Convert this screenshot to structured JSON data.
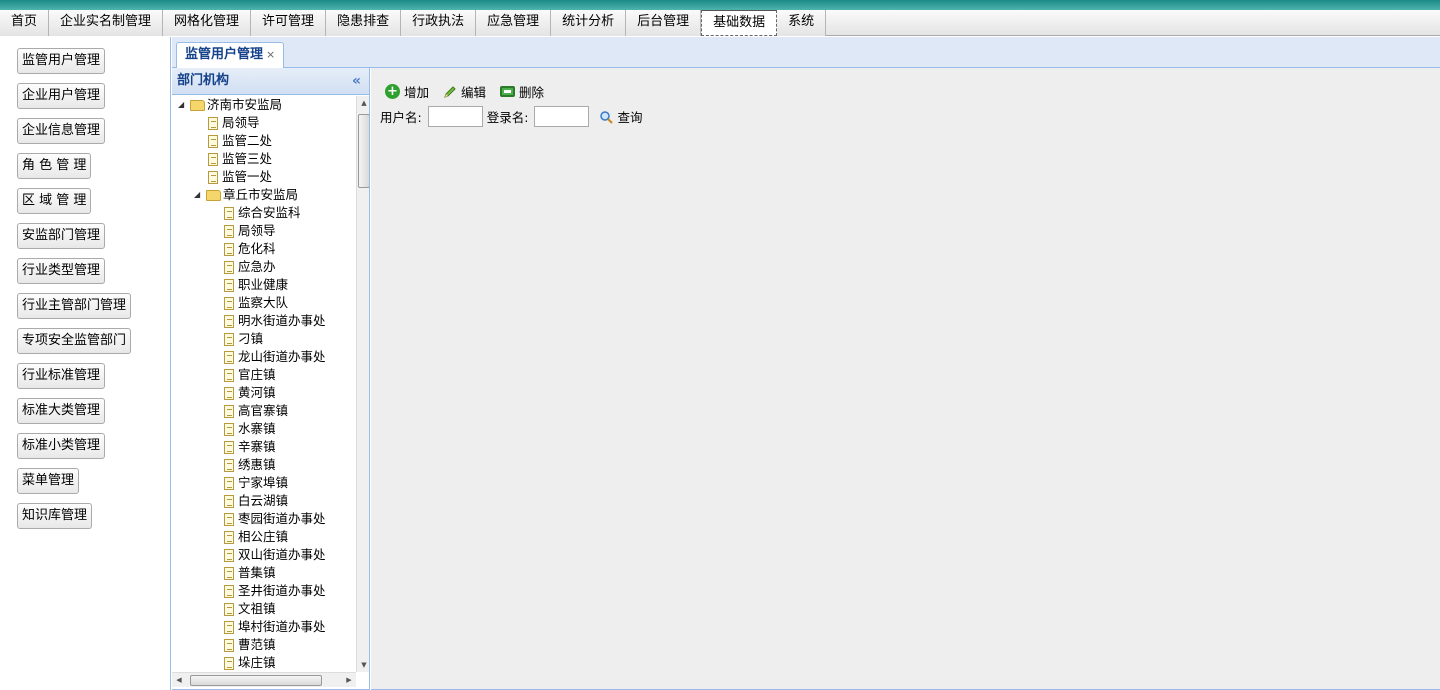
{
  "menu": {
    "items": [
      "首页",
      "企业实名制管理",
      "网格化管理",
      "许可管理",
      "隐患排查",
      "行政执法",
      "应急管理",
      "统计分析",
      "后台管理",
      "基础数据",
      "系统"
    ],
    "active": "基础数据"
  },
  "sidebar": {
    "items": [
      "监管用户管理",
      "企业用户管理",
      "企业信息管理",
      "角 色 管 理",
      "区 域 管 理",
      "安监部门管理",
      "行业类型管理",
      "行业主管部门管理",
      "专项安全监管部门",
      "行业标准管理",
      "标准大类管理",
      "标准小类管理",
      "菜单管理",
      "知识库管理"
    ]
  },
  "tab": {
    "label": "监管用户管理",
    "close": "×"
  },
  "tree": {
    "title": "部门机构",
    "collapse": "«",
    "nodes": [
      {
        "label": "济南市安监局",
        "level": 0,
        "type": "folder",
        "expanded": true
      },
      {
        "label": "局领导",
        "level": 1,
        "type": "file"
      },
      {
        "label": "监管二处",
        "level": 1,
        "type": "file"
      },
      {
        "label": "监管三处",
        "level": 1,
        "type": "file"
      },
      {
        "label": "监管一处",
        "level": 1,
        "type": "file"
      },
      {
        "label": "章丘市安监局",
        "level": 1,
        "type": "folder",
        "expanded": true
      },
      {
        "label": "综合安监科",
        "level": 2,
        "type": "file"
      },
      {
        "label": "局领导",
        "level": 2,
        "type": "file"
      },
      {
        "label": "危化科",
        "level": 2,
        "type": "file"
      },
      {
        "label": "应急办",
        "level": 2,
        "type": "file"
      },
      {
        "label": "职业健康",
        "level": 2,
        "type": "file"
      },
      {
        "label": "监察大队",
        "level": 2,
        "type": "file"
      },
      {
        "label": "明水街道办事处",
        "level": 2,
        "type": "file"
      },
      {
        "label": "刁镇",
        "level": 2,
        "type": "file"
      },
      {
        "label": "龙山街道办事处",
        "level": 2,
        "type": "file"
      },
      {
        "label": "官庄镇",
        "level": 2,
        "type": "file"
      },
      {
        "label": "黄河镇",
        "level": 2,
        "type": "file"
      },
      {
        "label": "高官寨镇",
        "level": 2,
        "type": "file"
      },
      {
        "label": "水寨镇",
        "level": 2,
        "type": "file"
      },
      {
        "label": "辛寨镇",
        "level": 2,
        "type": "file"
      },
      {
        "label": "绣惠镇",
        "level": 2,
        "type": "file"
      },
      {
        "label": "宁家埠镇",
        "level": 2,
        "type": "file"
      },
      {
        "label": "白云湖镇",
        "level": 2,
        "type": "file"
      },
      {
        "label": "枣园街道办事处",
        "level": 2,
        "type": "file"
      },
      {
        "label": "相公庄镇",
        "level": 2,
        "type": "file"
      },
      {
        "label": "双山街道办事处",
        "level": 2,
        "type": "file"
      },
      {
        "label": "普集镇",
        "level": 2,
        "type": "file"
      },
      {
        "label": "圣井街道办事处",
        "level": 2,
        "type": "file"
      },
      {
        "label": "文祖镇",
        "level": 2,
        "type": "file"
      },
      {
        "label": "埠村街道办事处",
        "level": 2,
        "type": "file"
      },
      {
        "label": "曹范镇",
        "level": 2,
        "type": "file"
      },
      {
        "label": "垛庄镇",
        "level": 2,
        "type": "file"
      }
    ]
  },
  "toolbar": {
    "add_label": "增加",
    "edit_label": "编辑",
    "delete_label": "删除"
  },
  "search": {
    "username_label": "用户名:",
    "username_value": "",
    "login_label": "登录名:",
    "login_value": "",
    "query_label": "查询"
  },
  "colors": {
    "accent": "#15428b",
    "panel_border": "#99bbe8",
    "content_bg": "#eeeeee",
    "add_icon": "#2ea02e"
  }
}
